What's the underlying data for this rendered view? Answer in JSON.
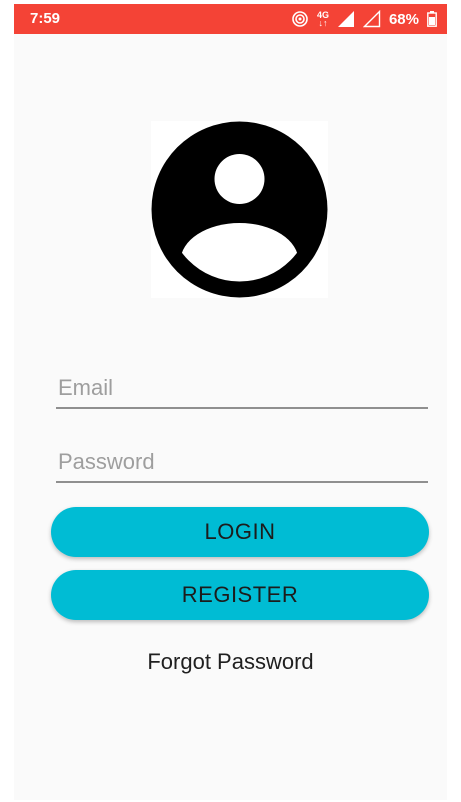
{
  "status_bar": {
    "time": "7:59",
    "network": "4G",
    "battery": "68%",
    "icons": [
      "hotspot-icon",
      "network-4g-icon",
      "signal-icon",
      "signal-empty-icon",
      "battery-icon"
    ]
  },
  "avatar": {
    "icon": "account-circle-icon"
  },
  "form": {
    "email_placeholder": "Email",
    "password_placeholder": "Password"
  },
  "buttons": {
    "login_label": "LOGIN",
    "register_label": "REGISTER",
    "accent_color": "#00bcd4"
  },
  "forgot_password_label": "Forgot Password",
  "colors": {
    "status_bar": "#f44336",
    "background": "#fafafa"
  }
}
